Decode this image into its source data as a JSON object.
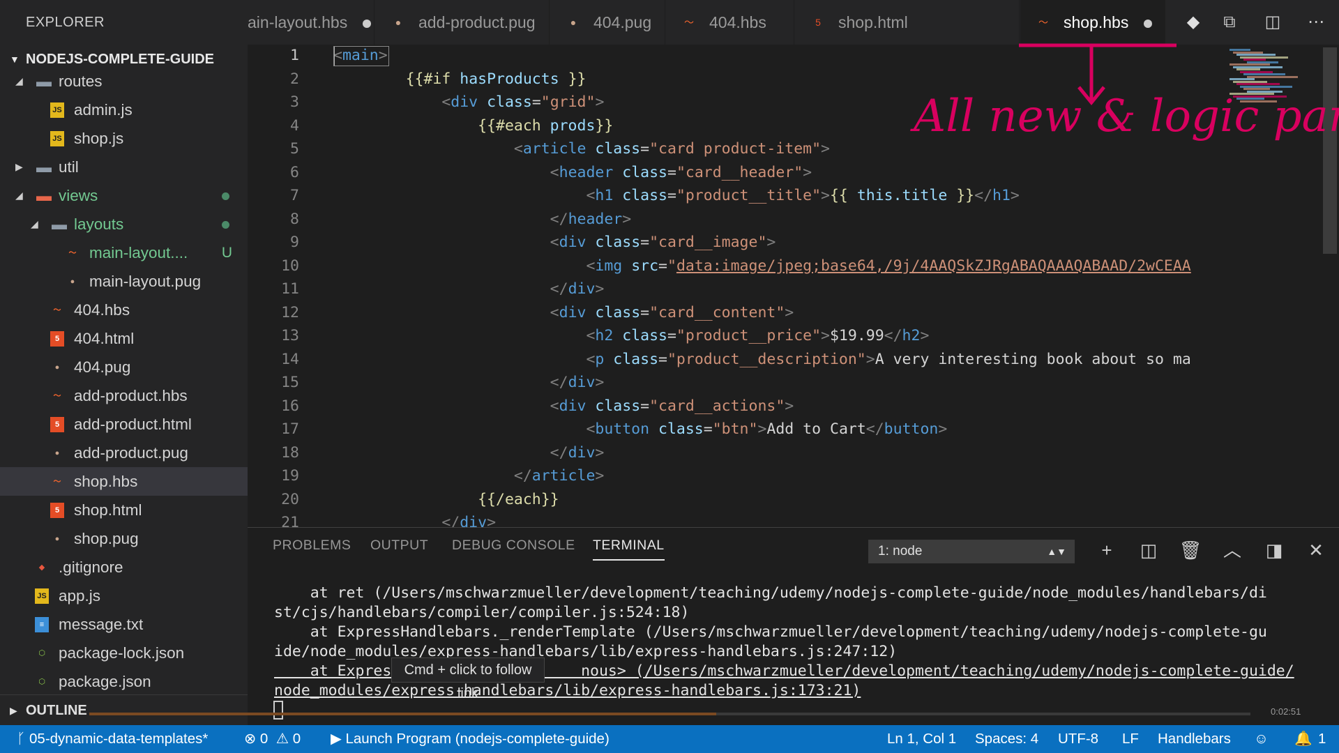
{
  "sidebar": {
    "title": "EXPLORER",
    "project": "NODEJS-COMPLETE-GUIDE",
    "outline_label": "OUTLINE"
  },
  "tree": [
    {
      "label": "routes",
      "indent": 1,
      "arrow": "down",
      "icon": "folder-open",
      "color": "#d4d4d4"
    },
    {
      "label": "admin.js",
      "indent": 2,
      "icon": "js",
      "color": "#d4d4d4"
    },
    {
      "label": "shop.js",
      "indent": 2,
      "icon": "js",
      "color": "#d4d4d4"
    },
    {
      "label": "util",
      "indent": 1,
      "arrow": "right",
      "icon": "folder",
      "color": "#d4d4d4"
    },
    {
      "label": "views",
      "indent": 1,
      "arrow": "down",
      "icon": "folder-open-red",
      "color": "#73c991",
      "dot": true
    },
    {
      "label": "layouts",
      "indent": 2,
      "arrow": "down",
      "icon": "folder-open",
      "color": "#73c991",
      "dot": true
    },
    {
      "label": "main-layout....",
      "indent": 3,
      "icon": "hbs",
      "color": "#73c991",
      "badge": "U"
    },
    {
      "label": "main-layout.pug",
      "indent": 3,
      "icon": "pug",
      "color": "#d4d4d4"
    },
    {
      "label": "404.hbs",
      "indent": 2,
      "icon": "hbs",
      "color": "#d4d4d4"
    },
    {
      "label": "404.html",
      "indent": 2,
      "icon": "html",
      "color": "#d4d4d4"
    },
    {
      "label": "404.pug",
      "indent": 2,
      "icon": "pug",
      "color": "#d4d4d4"
    },
    {
      "label": "add-product.hbs",
      "indent": 2,
      "icon": "hbs",
      "color": "#d4d4d4"
    },
    {
      "label": "add-product.html",
      "indent": 2,
      "icon": "html",
      "color": "#d4d4d4"
    },
    {
      "label": "add-product.pug",
      "indent": 2,
      "icon": "pug",
      "color": "#d4d4d4"
    },
    {
      "label": "shop.hbs",
      "indent": 2,
      "icon": "hbs",
      "color": "#d4d4d4",
      "selected": true
    },
    {
      "label": "shop.html",
      "indent": 2,
      "icon": "html",
      "color": "#d4d4d4"
    },
    {
      "label": "shop.pug",
      "indent": 2,
      "icon": "pug",
      "color": "#d4d4d4"
    },
    {
      "label": ".gitignore",
      "indent": 1,
      "icon": "git",
      "color": "#d4d4d4"
    },
    {
      "label": "app.js",
      "indent": 1,
      "icon": "js",
      "color": "#d4d4d4"
    },
    {
      "label": "message.txt",
      "indent": 1,
      "icon": "txt",
      "color": "#d4d4d4"
    },
    {
      "label": "package-lock.json",
      "indent": 1,
      "icon": "node",
      "color": "#d4d4d4"
    },
    {
      "label": "package.json",
      "indent": 1,
      "icon": "node",
      "color": "#d4d4d4"
    }
  ],
  "tabs": [
    {
      "label": "ain-layout.hbs",
      "icon": "hbs",
      "modified": true
    },
    {
      "label": "add-product.pug",
      "icon": "pug"
    },
    {
      "label": "404.pug",
      "icon": "pug"
    },
    {
      "label": "404.hbs",
      "icon": "hbs"
    },
    {
      "label": "shop.html",
      "icon": "html"
    },
    {
      "label": "shop.hbs",
      "icon": "hbs",
      "modified": true,
      "active": true
    }
  ],
  "editor": {
    "lines": [
      {
        "n": "1",
        "html": "<span class='pc'>&lt;</span><span class='tg'>main</span><span class='pc'>&gt;</span>"
      },
      {
        "n": "2",
        "html": "        <span class='hb'>{{#if</span> <span class='at'>hasProducts</span> <span class='hb'>}}</span>"
      },
      {
        "n": "3",
        "html": "            <span class='pc'>&lt;</span><span class='tg'>div</span> <span class='at'>class</span><span class='tx'>=</span><span class='st'>\"grid\"</span><span class='pc'>&gt;</span>"
      },
      {
        "n": "4",
        "html": "                <span class='hb'>{{#each</span> <span class='at'>prods</span><span class='hb'>}}</span>"
      },
      {
        "n": "5",
        "html": "                    <span class='pc'>&lt;</span><span class='tg'>article</span> <span class='at'>class</span><span class='tx'>=</span><span class='st'>\"card product-item\"</span><span class='pc'>&gt;</span>"
      },
      {
        "n": "6",
        "html": "                        <span class='pc'>&lt;</span><span class='tg'>header</span> <span class='at'>class</span><span class='tx'>=</span><span class='st'>\"card__header\"</span><span class='pc'>&gt;</span>"
      },
      {
        "n": "7",
        "html": "                            <span class='pc'>&lt;</span><span class='tg'>h1</span> <span class='at'>class</span><span class='tx'>=</span><span class='st'>\"product__title\"</span><span class='pc'>&gt;</span><span class='hb'>{{</span> <span class='at'>this.title</span> <span class='hb'>}}</span><span class='pc'>&lt;/</span><span class='tg'>h1</span><span class='pc'>&gt;</span>"
      },
      {
        "n": "8",
        "html": "                        <span class='pc'>&lt;/</span><span class='tg'>header</span><span class='pc'>&gt;</span>"
      },
      {
        "n": "9",
        "html": "                        <span class='pc'>&lt;</span><span class='tg'>div</span> <span class='at'>class</span><span class='tx'>=</span><span class='st'>\"card__image\"</span><span class='pc'>&gt;</span>"
      },
      {
        "n": "10",
        "html": "                            <span class='pc'>&lt;</span><span class='tg'>img</span> <span class='at'>src</span><span class='tx'>=</span><span class='st'>\"<u>data:image/jpeg;base64,/9j/4AAQSkZJRgABAQAAAQABAAD/2wCEAA</u></span>"
      },
      {
        "n": "11",
        "html": "                        <span class='pc'>&lt;/</span><span class='tg'>div</span><span class='pc'>&gt;</span>"
      },
      {
        "n": "12",
        "html": "                        <span class='pc'>&lt;</span><span class='tg'>div</span> <span class='at'>class</span><span class='tx'>=</span><span class='st'>\"card__content\"</span><span class='pc'>&gt;</span>"
      },
      {
        "n": "13",
        "html": "                            <span class='pc'>&lt;</span><span class='tg'>h2</span> <span class='at'>class</span><span class='tx'>=</span><span class='st'>\"product__price\"</span><span class='pc'>&gt;</span><span class='tx'>$19.99</span><span class='pc'>&lt;/</span><span class='tg'>h2</span><span class='pc'>&gt;</span>"
      },
      {
        "n": "14",
        "html": "                            <span class='pc'>&lt;</span><span class='tg'>p</span> <span class='at'>class</span><span class='tx'>=</span><span class='st'>\"product__description\"</span><span class='pc'>&gt;</span><span class='tx'>A very interesting book about so ma</span>"
      },
      {
        "n": "15",
        "html": "                        <span class='pc'>&lt;/</span><span class='tg'>div</span><span class='pc'>&gt;</span>"
      },
      {
        "n": "16",
        "html": "                        <span class='pc'>&lt;</span><span class='tg'>div</span> <span class='at'>class</span><span class='tx'>=</span><span class='st'>\"card__actions\"</span><span class='pc'>&gt;</span>"
      },
      {
        "n": "17",
        "html": "                            <span class='pc'>&lt;</span><span class='tg'>button</span> <span class='at'>class</span><span class='tx'>=</span><span class='st'>\"btn\"</span><span class='pc'>&gt;</span><span class='tx'>Add to Cart</span><span class='pc'>&lt;/</span><span class='tg'>button</span><span class='pc'>&gt;</span>"
      },
      {
        "n": "18",
        "html": "                        <span class='pc'>&lt;/</span><span class='tg'>div</span><span class='pc'>&gt;</span>"
      },
      {
        "n": "19",
        "html": "                    <span class='pc'>&lt;/</span><span class='tg'>article</span><span class='pc'>&gt;</span>"
      },
      {
        "n": "20",
        "html": "                <span class='hb'>{{/each}}</span>"
      },
      {
        "n": "21",
        "html": "            <span class='pc'>&lt;/</span><span class='tg'>div</span><span class='pc'>&gt;</span>"
      }
    ]
  },
  "annotation": {
    "text": "All new & logic part",
    "color": "#d8005f"
  },
  "panel": {
    "tabs": [
      "PROBLEMS",
      "OUTPUT",
      "DEBUG CONSOLE",
      "TERMINAL"
    ],
    "active_tab": "TERMINAL",
    "terminal_select": "1: node",
    "terminal_lines": [
      "    at ret (/Users/mschwarzmueller/development/teaching/udemy/nodejs-complete-guide/node_modules/handlebars/di",
      "st/cjs/handlebars/compiler/compiler.js:524:18)",
      "    at ExpressHandlebars._renderTemplate (/Users/mschwarzmueller/development/teaching/udemy/nodejs-complete-gu",
      "ide/node_modules/express-handlebars/lib/express-handlebars.js:247:12)",
      "    at Expres                     nous> (/Users/mschwarzmueller/development/teaching/udemy/nodejs-complete-guide/",
      "node_modules/express-handlebars/lib/express-handlebars.js:173:21)"
    ],
    "tooltip": "Cmd + click to follow link"
  },
  "statusbar": {
    "branch": "05-dynamic-data-templates*",
    "errors": "0",
    "warnings": "0",
    "launch": "Launch Program (nodejs-complete-guide)",
    "position": "Ln 1, Col 1",
    "spaces": "Spaces: 4",
    "encoding": "UTF-8",
    "eol": "LF",
    "language": "Handlebars",
    "bell_count": "1"
  },
  "video": {
    "time": "0:02:51",
    "progress": 0.54
  },
  "colors": {
    "statusbar": "#0a70c0",
    "sidebar": "#252526",
    "editor": "#1e1e1e",
    "tag": "#569cd6",
    "attribute": "#9cdcfe",
    "string": "#ce9178",
    "handlebars": "#dcdcaa",
    "untracked": "#73c991"
  }
}
